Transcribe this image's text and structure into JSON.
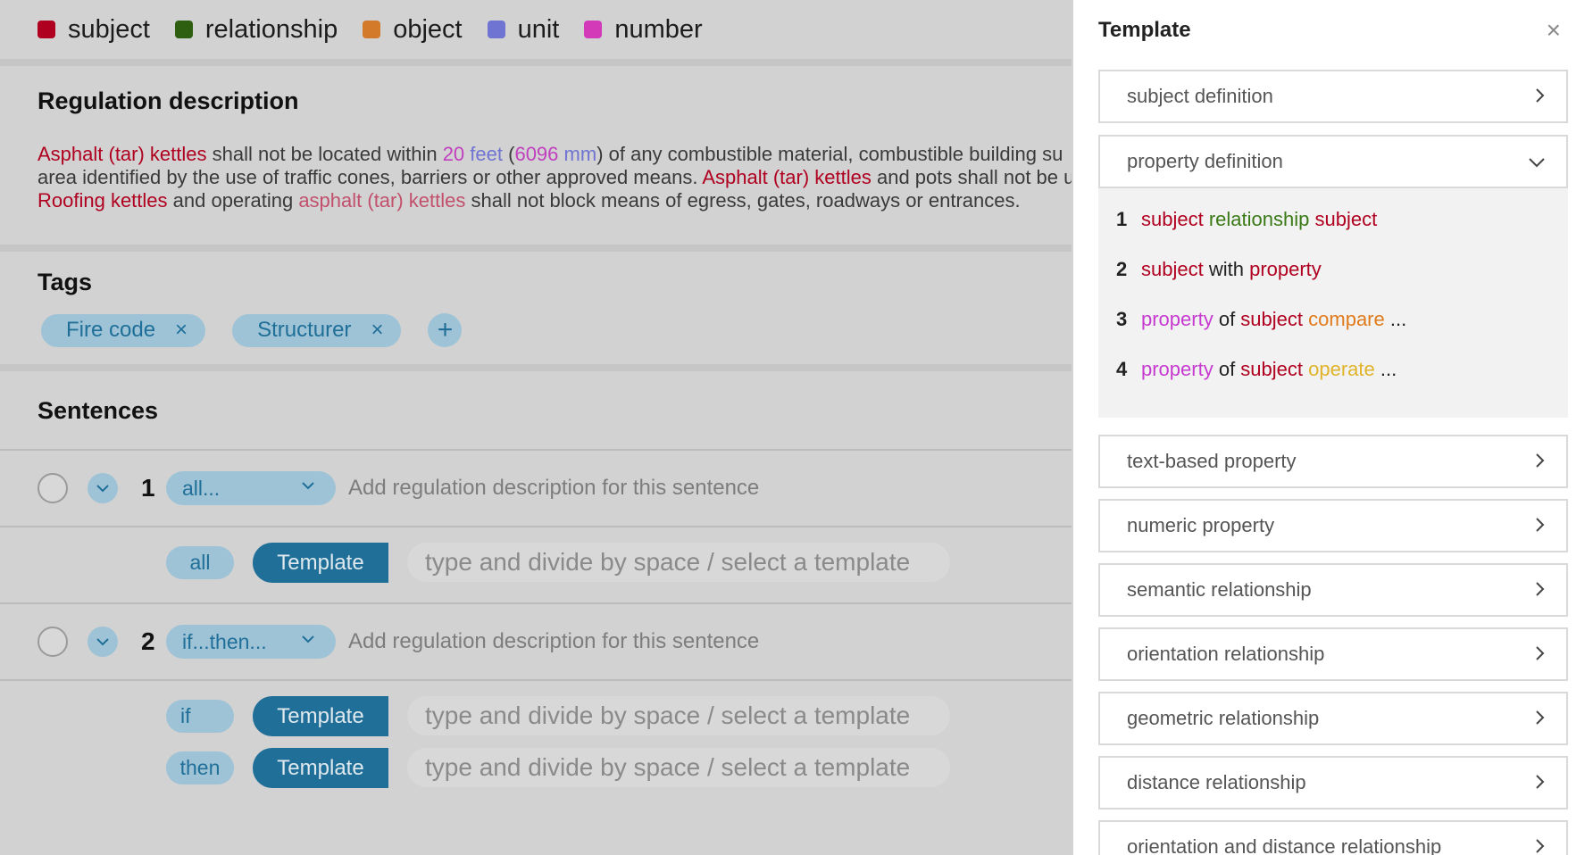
{
  "legend": [
    {
      "label": "subject",
      "color": "#b00020"
    },
    {
      "label": "relationship",
      "color": "#2e5e10"
    },
    {
      "label": "object",
      "color": "#d27a2a"
    },
    {
      "label": "unit",
      "color": "#6f73d2"
    },
    {
      "label": "number",
      "color": "#d23ab8"
    }
  ],
  "regulation": {
    "title": "Regulation description",
    "line1": {
      "p1": "Asphalt (tar) kettles",
      "p2": " shall not be located within ",
      "p3": "20",
      "p4": " ",
      "p5": "feet",
      "p6": " (",
      "p7": "6096",
      "p8": " ",
      "p9": "mm",
      "p10": ") of any combustible material, combustible building su"
    },
    "line2": {
      "p1": "area identified by the use of traffic cones, barriers or other approved means. ",
      "p2": "Asphalt (tar) kettles",
      "p3": " and pots shall not be u"
    },
    "line3": {
      "p1": "Roofing kettles",
      "p2": " and operating ",
      "p3": "asphalt (tar) kettles",
      "p4": " shall not block means of egress, gates, roadways or entrances."
    }
  },
  "tags": {
    "title": "Tags",
    "items": [
      "Fire code",
      "Structurer"
    ],
    "remove_glyph": "×",
    "add_glyph": "+"
  },
  "sentences": {
    "title": "Sentences",
    "rows": [
      {
        "number": "1",
        "type": "all...",
        "description_placeholder": "Add regulation description for this sentence",
        "clauses": [
          {
            "keyword": "all",
            "template_label": "Template",
            "input_placeholder": "type and divide by space / select a template"
          }
        ]
      },
      {
        "number": "2",
        "type": "if...then...",
        "description_placeholder": "Add regulation description for this sentence",
        "clauses": [
          {
            "keyword": "if",
            "template_label": "Template",
            "input_placeholder": "type and divide by space / select a template"
          },
          {
            "keyword": "then",
            "template_label": "Template",
            "input_placeholder": "type and divide by space / select a template"
          }
        ]
      }
    ]
  },
  "panel": {
    "title": "Template",
    "close_glyph": "×",
    "sections": [
      {
        "label": "subject definition",
        "expanded": false
      },
      {
        "label": "property definition",
        "expanded": true
      },
      {
        "label": "text-based property",
        "expanded": false
      },
      {
        "label": "numeric property",
        "expanded": false
      },
      {
        "label": "semantic relationship",
        "expanded": false
      },
      {
        "label": "orientation relationship",
        "expanded": false
      },
      {
        "label": "geometric relationship",
        "expanded": false
      },
      {
        "label": "distance relationship",
        "expanded": false
      },
      {
        "label": "orientation and distance relationship",
        "expanded": false
      }
    ],
    "property_templates": [
      {
        "index": "1",
        "parts": [
          [
            "subject",
            "c-subj"
          ],
          [
            " "
          ],
          [
            "relationship",
            "c-rel"
          ],
          [
            " "
          ],
          [
            "subject",
            "c-subj"
          ]
        ]
      },
      {
        "index": "2",
        "parts": [
          [
            "subject",
            "c-subj"
          ],
          [
            " with ",
            "c-plain"
          ],
          [
            "property",
            "c-subj"
          ]
        ]
      },
      {
        "index": "3",
        "parts": [
          [
            "property",
            "c-num"
          ],
          [
            " of ",
            "c-plain"
          ],
          [
            "subject",
            "c-subj"
          ],
          [
            " "
          ],
          [
            "compare",
            "c-obj"
          ],
          [
            " ...",
            "c-plain"
          ]
        ]
      },
      {
        "index": "4",
        "parts": [
          [
            "property",
            "c-num"
          ],
          [
            " of ",
            "c-plain"
          ],
          [
            "subject",
            "c-subj"
          ],
          [
            " "
          ],
          [
            "operate",
            "c-op"
          ],
          [
            " ...",
            "c-plain"
          ]
        ]
      }
    ]
  }
}
